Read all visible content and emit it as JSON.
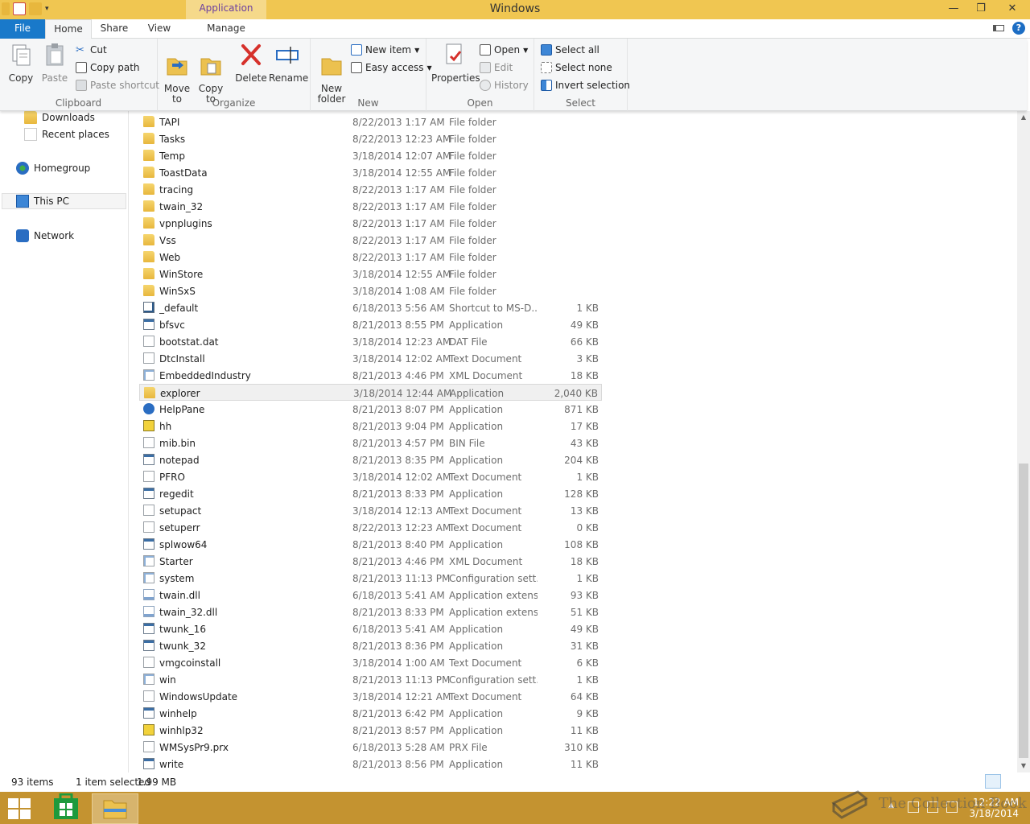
{
  "window": {
    "title": "Windows",
    "context_tab_group": "Application Tools",
    "minimize": "—",
    "maximize": "❐",
    "close": "✕"
  },
  "tabs": {
    "file": "File",
    "home": "Home",
    "share": "Share",
    "view": "View",
    "manage": "Manage"
  },
  "ribbon": {
    "clipboard": {
      "label": "Clipboard",
      "copy": "Copy",
      "paste": "Paste",
      "cut": "Cut",
      "copy_path": "Copy path",
      "paste_shortcut": "Paste shortcut"
    },
    "organize": {
      "label": "Organize",
      "move_to": "Move\nto",
      "copy_to": "Copy\nto",
      "delete": "Delete",
      "rename": "Rename"
    },
    "new": {
      "label": "New",
      "new_folder": "New\nfolder",
      "new_item": "New item",
      "easy_access": "Easy access"
    },
    "open": {
      "label": "Open",
      "properties": "Properties",
      "open": "Open",
      "edit": "Edit",
      "history": "History"
    },
    "select": {
      "label": "Select",
      "select_all": "Select all",
      "select_none": "Select none",
      "invert_selection": "Invert selection"
    }
  },
  "nav": {
    "downloads": "Downloads",
    "recent_places": "Recent places",
    "homegroup": "Homegroup",
    "this_pc": "This PC",
    "network": "Network"
  },
  "files": [
    {
      "name": "TAPI",
      "date": "8/22/2013 1:17 AM",
      "type": "File folder",
      "size": "",
      "icon": "folder"
    },
    {
      "name": "Tasks",
      "date": "8/22/2013 12:23 AM",
      "type": "File folder",
      "size": "",
      "icon": "folder"
    },
    {
      "name": "Temp",
      "date": "3/18/2014 12:07 AM",
      "type": "File folder",
      "size": "",
      "icon": "folder"
    },
    {
      "name": "ToastData",
      "date": "3/18/2014 12:55 AM",
      "type": "File folder",
      "size": "",
      "icon": "folder"
    },
    {
      "name": "tracing",
      "date": "8/22/2013 1:17 AM",
      "type": "File folder",
      "size": "",
      "icon": "folder"
    },
    {
      "name": "twain_32",
      "date": "8/22/2013 1:17 AM",
      "type": "File folder",
      "size": "",
      "icon": "folder"
    },
    {
      "name": "vpnplugins",
      "date": "8/22/2013 1:17 AM",
      "type": "File folder",
      "size": "",
      "icon": "folder"
    },
    {
      "name": "Vss",
      "date": "8/22/2013 1:17 AM",
      "type": "File folder",
      "size": "",
      "icon": "folder"
    },
    {
      "name": "Web",
      "date": "8/22/2013 1:17 AM",
      "type": "File folder",
      "size": "",
      "icon": "folder"
    },
    {
      "name": "WinStore",
      "date": "3/18/2014 12:55 AM",
      "type": "File folder",
      "size": "",
      "icon": "folder"
    },
    {
      "name": "WinSxS",
      "date": "3/18/2014 1:08 AM",
      "type": "File folder",
      "size": "",
      "icon": "folder"
    },
    {
      "name": "_default",
      "date": "6/18/2013 5:56 AM",
      "type": "Shortcut to MS-D...",
      "size": "1 KB",
      "icon": "shortcut"
    },
    {
      "name": "bfsvc",
      "date": "8/21/2013 8:55 PM",
      "type": "Application",
      "size": "49 KB",
      "icon": "app"
    },
    {
      "name": "bootstat.dat",
      "date": "3/18/2014 12:23 AM",
      "type": "DAT File",
      "size": "66 KB",
      "icon": "doc"
    },
    {
      "name": "DtcInstall",
      "date": "3/18/2014 12:02 AM",
      "type": "Text Document",
      "size": "3 KB",
      "icon": "doc"
    },
    {
      "name": "EmbeddedIndustry",
      "date": "8/21/2013 4:46 PM",
      "type": "XML Document",
      "size": "18 KB",
      "icon": "cfg"
    },
    {
      "name": "explorer",
      "date": "3/18/2014 12:44 AM",
      "type": "Application",
      "size": "2,040 KB",
      "icon": "folder",
      "selected": true
    },
    {
      "name": "HelpPane",
      "date": "8/21/2013 8:07 PM",
      "type": "Application",
      "size": "871 KB",
      "icon": "help"
    },
    {
      "name": "hh",
      "date": "8/21/2013 9:04 PM",
      "type": "Application",
      "size": "17 KB",
      "icon": "hh"
    },
    {
      "name": "mib.bin",
      "date": "8/21/2013 4:57 PM",
      "type": "BIN File",
      "size": "43 KB",
      "icon": "doc"
    },
    {
      "name": "notepad",
      "date": "8/21/2013 8:35 PM",
      "type": "Application",
      "size": "204 KB",
      "icon": "app"
    },
    {
      "name": "PFRO",
      "date": "3/18/2014 12:02 AM",
      "type": "Text Document",
      "size": "1 KB",
      "icon": "doc"
    },
    {
      "name": "regedit",
      "date": "8/21/2013 8:33 PM",
      "type": "Application",
      "size": "128 KB",
      "icon": "app"
    },
    {
      "name": "setupact",
      "date": "3/18/2014 12:13 AM",
      "type": "Text Document",
      "size": "13 KB",
      "icon": "doc"
    },
    {
      "name": "setuperr",
      "date": "8/22/2013 12:23 AM",
      "type": "Text Document",
      "size": "0 KB",
      "icon": "doc"
    },
    {
      "name": "splwow64",
      "date": "8/21/2013 8:40 PM",
      "type": "Application",
      "size": "108 KB",
      "icon": "app"
    },
    {
      "name": "Starter",
      "date": "8/21/2013 4:46 PM",
      "type": "XML Document",
      "size": "18 KB",
      "icon": "cfg"
    },
    {
      "name": "system",
      "date": "8/21/2013 11:13 PM",
      "type": "Configuration sett...",
      "size": "1 KB",
      "icon": "cfg"
    },
    {
      "name": "twain.dll",
      "date": "6/18/2013 5:41 AM",
      "type": "Application extens...",
      "size": "93 KB",
      "icon": "dll"
    },
    {
      "name": "twain_32.dll",
      "date": "8/21/2013 8:33 PM",
      "type": "Application extens...",
      "size": "51 KB",
      "icon": "dll"
    },
    {
      "name": "twunk_16",
      "date": "6/18/2013 5:41 AM",
      "type": "Application",
      "size": "49 KB",
      "icon": "app"
    },
    {
      "name": "twunk_32",
      "date": "8/21/2013 8:36 PM",
      "type": "Application",
      "size": "31 KB",
      "icon": "app"
    },
    {
      "name": "vmgcoinstall",
      "date": "3/18/2014 1:00 AM",
      "type": "Text Document",
      "size": "6 KB",
      "icon": "doc"
    },
    {
      "name": "win",
      "date": "8/21/2013 11:13 PM",
      "type": "Configuration sett...",
      "size": "1 KB",
      "icon": "cfg"
    },
    {
      "name": "WindowsUpdate",
      "date": "3/18/2014 12:21 AM",
      "type": "Text Document",
      "size": "64 KB",
      "icon": "doc"
    },
    {
      "name": "winhelp",
      "date": "8/21/2013 6:42 PM",
      "type": "Application",
      "size": "9 KB",
      "icon": "app"
    },
    {
      "name": "winhlp32",
      "date": "8/21/2013 8:57 PM",
      "type": "Application",
      "size": "11 KB",
      "icon": "hh"
    },
    {
      "name": "WMSysPr9.prx",
      "date": "6/18/2013 5:28 AM",
      "type": "PRX File",
      "size": "310 KB",
      "icon": "doc"
    },
    {
      "name": "write",
      "date": "8/21/2013 8:56 PM",
      "type": "Application",
      "size": "11 KB",
      "icon": "app"
    }
  ],
  "status": {
    "item_count": "93 items",
    "selection": "1 item selected",
    "size": "1.99 MB"
  },
  "taskbar": {
    "time": "12:22 AM",
    "date": "3/18/2014"
  },
  "watermark": "The Collection Book",
  "colors": {
    "title_bar": "#f0c651",
    "file_tab": "#1979ca",
    "taskbar": "#c49330",
    "context_tab": "#f5d98a"
  }
}
